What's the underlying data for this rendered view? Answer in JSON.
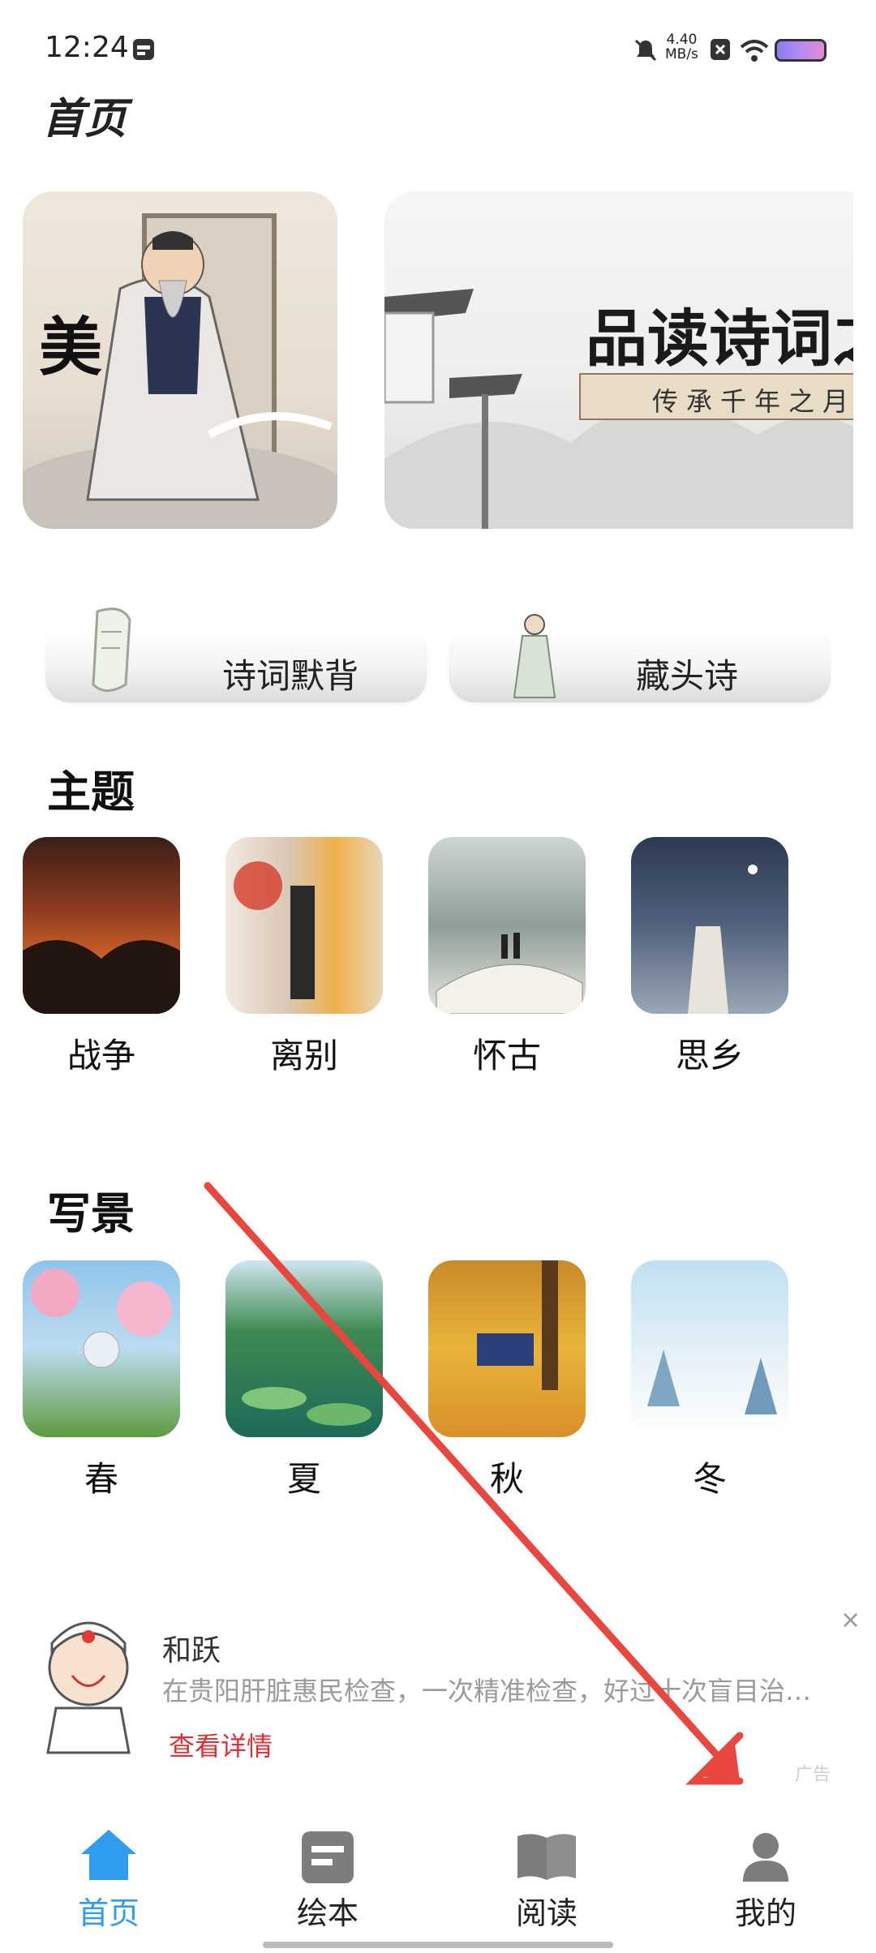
{
  "status_bar": {
    "time": "12:24",
    "net_speed_value": "4.40",
    "net_speed_unit": "MB/s"
  },
  "page_title": "首页",
  "banners": {
    "first_char": "美",
    "second_title": "品读诗词之",
    "second_subtitle": "传承千年之月"
  },
  "quick_entries": [
    {
      "label": "诗词默背",
      "icon": "scroll-icon"
    },
    {
      "label": "藏头诗",
      "icon": "poet-figure-icon"
    }
  ],
  "sections": {
    "themes": {
      "title": "主题",
      "items": [
        {
          "label": "战争"
        },
        {
          "label": "离别"
        },
        {
          "label": "怀古"
        },
        {
          "label": "思乡"
        }
      ]
    },
    "scenery": {
      "title": "写景",
      "items": [
        {
          "label": "春"
        },
        {
          "label": "夏"
        },
        {
          "label": "秋"
        },
        {
          "label": "冬"
        }
      ]
    }
  },
  "ad": {
    "name": "和跃",
    "description": "在贵阳肝脏惠民检查，一次精准检查，好过十次盲目治…",
    "link": "查看详情",
    "close": "×",
    "tag": "广告"
  },
  "bottom_nav": [
    {
      "label": "首页",
      "icon": "home-icon",
      "active": true
    },
    {
      "label": "绘本",
      "icon": "picture-book-icon",
      "active": false
    },
    {
      "label": "阅读",
      "icon": "book-icon",
      "active": false
    },
    {
      "label": "我的",
      "icon": "profile-icon",
      "active": false
    }
  ],
  "colors": {
    "accent": "#2f9cf0",
    "link_red": "#e02e36",
    "annotation_arrow": "#e8463f"
  }
}
